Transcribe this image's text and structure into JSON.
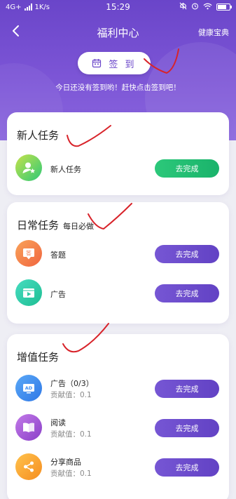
{
  "status_bar": {
    "network": "4G+",
    "speed": "1K/s",
    "time": "15:29"
  },
  "nav": {
    "title": "福利中心",
    "right_link": "健康宝典"
  },
  "signin": {
    "label": "签 到",
    "tip": "今日还没有签到哟！赶快点击签到吧！"
  },
  "sections": {
    "newbie": {
      "title": "新人任务",
      "tasks": [
        {
          "name": "新人任务",
          "button": "去完成",
          "icon": "user-star-icon",
          "color": "#2ec977"
        }
      ]
    },
    "daily": {
      "title": "日常任务",
      "subtitle": "每日必做",
      "tasks": [
        {
          "name": "答题",
          "button": "去完成",
          "icon": "quiz-icon",
          "color": "#f47a4c"
        },
        {
          "name": "广告",
          "button": "去完成",
          "icon": "video-icon",
          "color": "#2fc8a5"
        }
      ]
    },
    "value_added": {
      "title": "增值任务",
      "tasks": [
        {
          "name": "广告（0/3）",
          "contribution": "贡献值：0.1",
          "button": "去完成",
          "icon": "ad-icon",
          "color": "#3c8ef3"
        },
        {
          "name": "阅读",
          "contribution": "贡献值：0.1",
          "button": "去完成",
          "icon": "book-icon",
          "color": "#9a4fd1"
        },
        {
          "name": "分享商品",
          "contribution": "贡献值：0.1",
          "button": "去完成",
          "icon": "share-icon",
          "color": "#f6a623"
        }
      ]
    }
  },
  "colors": {
    "header_purple": "#6a45c9",
    "button_green": "#1fbe70",
    "button_purple": "#6a4ac8",
    "annotation_red": "#d8232a"
  }
}
